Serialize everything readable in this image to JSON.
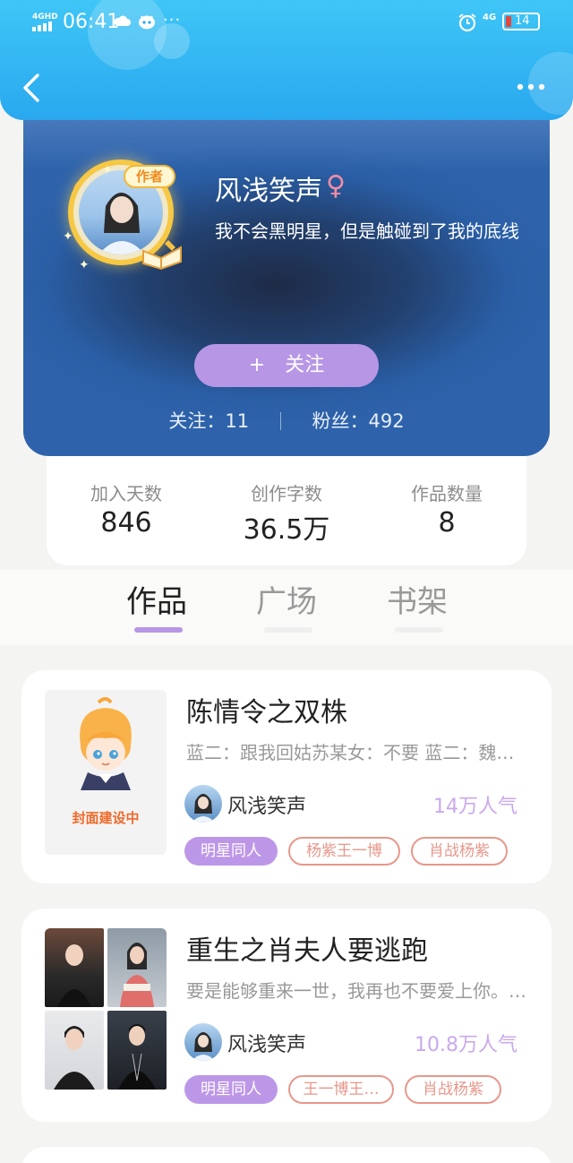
{
  "status_bar": {
    "network": "4GHD",
    "time": "06:41",
    "more": "···",
    "net_type": "4G",
    "battery": "14"
  },
  "profile": {
    "badge": "作者",
    "name": "风浅笑声",
    "gender_symbol": "♀",
    "bio": "我不会黑明星，但是触碰到了我的底线",
    "follow_plus": "+",
    "follow_label": "关注",
    "following_text": "关注：11",
    "fans_text": "粉丝：492"
  },
  "stats": [
    {
      "label": "加入天数",
      "value": "846"
    },
    {
      "label": "创作字数",
      "value": "36.5万"
    },
    {
      "label": "作品数量",
      "value": "8"
    }
  ],
  "tabs": [
    {
      "label": "作品",
      "active": true
    },
    {
      "label": "广场",
      "active": false
    },
    {
      "label": "书架",
      "active": false
    }
  ],
  "books": [
    {
      "title": "陈情令之双株",
      "description": "蓝二：跟我回姑苏某女：不要 蓝二：魏…",
      "cover_text": "封面建设中",
      "author": "风浅笑声",
      "popularity": "14万人气",
      "tags": [
        "明星同人",
        "杨紫王一博",
        "肖战杨紫"
      ]
    },
    {
      "title": "重生之肖夫人要逃跑",
      "description": "要是能够重来一世，我再也不要爱上你。…",
      "author": "风浅笑声",
      "popularity": "10.8万人气",
      "tags": [
        "明星同人",
        "王一博王…",
        "肖战杨紫"
      ]
    }
  ],
  "colors": {
    "header": "#29a8ef",
    "accent": "#b796e6",
    "tag_outline": "#e7978b",
    "popularity": "#c9a9ee"
  }
}
